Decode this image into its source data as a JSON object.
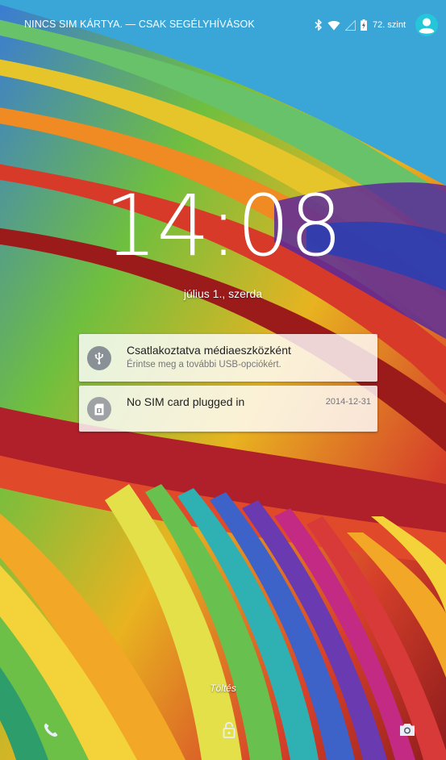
{
  "status_bar": {
    "carrier": "NINCS SIM KÁRTYA. — CSAK SEGÉLYHÍVÁSOK",
    "battery_label": "72. szint",
    "icons": [
      "bluetooth-icon",
      "wifi-icon",
      "signal-icon",
      "battery-charging-icon",
      "user-avatar-icon"
    ]
  },
  "lockscreen": {
    "time": "14:08",
    "date": "július 1., szerda",
    "charging_label": "Töltés"
  },
  "notifications": [
    {
      "title": "Csatlakoztatva médiaeszközként",
      "subtitle": "Érintse meg a további USB-opciókért.",
      "icon": "usb-icon",
      "time": ""
    },
    {
      "title": "No SIM card plugged in",
      "subtitle": "",
      "icon": "sim-card-icon",
      "time": "2014-12-31"
    }
  ],
  "bottom_actions": [
    "phone-icon",
    "unlock-icon",
    "camera-icon"
  ],
  "colors": {
    "avatar_accent": "#26c6da",
    "notification_bg": "#ffffff",
    "icon_circle": "#8a9196"
  }
}
